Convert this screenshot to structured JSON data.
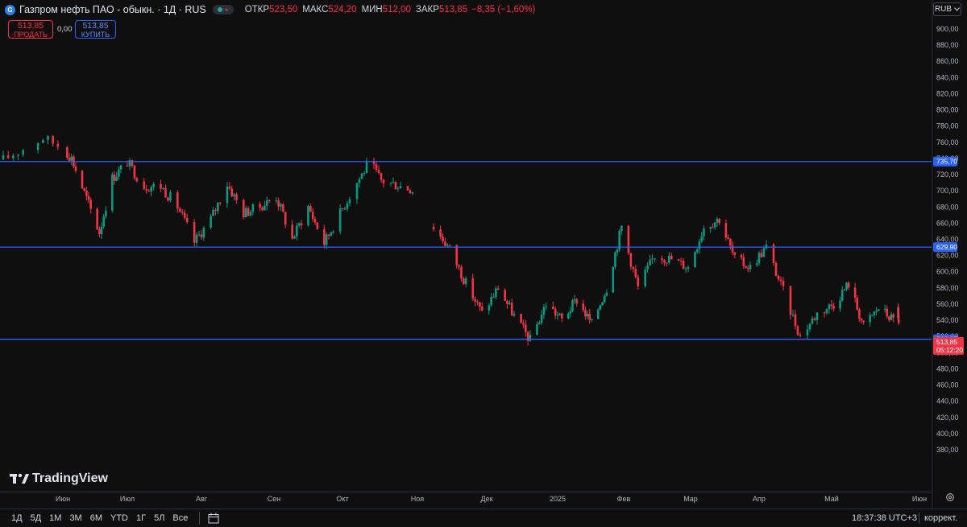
{
  "header": {
    "symbol_title": "Газпром нефть ПАО - обыкн. · 1Д · RUS",
    "logo_letter": "G",
    "open_label": "ОТКР",
    "open_value": "523,50",
    "high_label": "МАКС",
    "high_value": "524,20",
    "low_label": "МИН",
    "low_value": "512,00",
    "close_label": "ЗАКР",
    "close_value": "513,85",
    "change": "−8,35 (−1,60%)"
  },
  "trade": {
    "sell_price": "513,85",
    "sell_label": "ПРОДАТЬ",
    "spread": "0,00",
    "buy_price": "513,85",
    "buy_label": "КУПИТЬ"
  },
  "currency": "RUB",
  "brand": "TradingView",
  "timeframes": [
    "1Д",
    "5Д",
    "1М",
    "3М",
    "6М",
    "YTD",
    "1Г",
    "5Л",
    "Все"
  ],
  "clock": "18:37:38 UTC+3",
  "correction_label": "коррект.",
  "colors": {
    "up": "#089981",
    "down": "#f23645",
    "hline": "#2962ff",
    "bg": "#0f0f0f"
  },
  "chart_data": {
    "type": "candlestick",
    "y_axis": {
      "min": 360,
      "max": 900,
      "step": 20,
      "side": "right"
    },
    "x_labels": [
      "Июн",
      "Июл",
      "Авг",
      "Сен",
      "Окт",
      "Ноя",
      "Дек",
      "2025",
      "Фев",
      "Мар",
      "Апр",
      "Май",
      "Июн"
    ],
    "horizontal_lines": [
      735.7,
      629.9,
      516.05
    ],
    "last_price": 513.85,
    "countdown": "05:12:20",
    "close_path": [
      {
        "date": "2024-05-20",
        "close": 738
      },
      {
        "date": "2024-05-28",
        "close": 765
      },
      {
        "date": "2024-06-05",
        "close": 740
      },
      {
        "date": "2024-06-12",
        "close": 690
      },
      {
        "date": "2024-06-18",
        "close": 648
      },
      {
        "date": "2024-06-24",
        "close": 715
      },
      {
        "date": "2024-07-01",
        "close": 735
      },
      {
        "date": "2024-07-08",
        "close": 705
      },
      {
        "date": "2024-07-15",
        "close": 705
      },
      {
        "date": "2024-07-22",
        "close": 680
      },
      {
        "date": "2024-07-29",
        "close": 636
      },
      {
        "date": "2024-08-05",
        "close": 665
      },
      {
        "date": "2024-08-12",
        "close": 708
      },
      {
        "date": "2024-08-19",
        "close": 672
      },
      {
        "date": "2024-08-26",
        "close": 680
      },
      {
        "date": "2024-09-02",
        "close": 692
      },
      {
        "date": "2024-09-09",
        "close": 640
      },
      {
        "date": "2024-09-16",
        "close": 680
      },
      {
        "date": "2024-09-23",
        "close": 635
      },
      {
        "date": "2024-09-30",
        "close": 672
      },
      {
        "date": "2024-10-07",
        "close": 710
      },
      {
        "date": "2024-10-12",
        "close": 735
      },
      {
        "date": "2024-10-17",
        "close": 712
      },
      {
        "date": "2024-10-26",
        "close": 705
      },
      {
        "date": "2024-10-31",
        "close": 700
      },
      {
        "date": "2024-11-08",
        "close": 655
      },
      {
        "date": "2024-11-15",
        "close": 628
      },
      {
        "date": "2024-11-22",
        "close": 585
      },
      {
        "date": "2024-11-29",
        "close": 548
      },
      {
        "date": "2024-12-06",
        "close": 580
      },
      {
        "date": "2024-12-13",
        "close": 545
      },
      {
        "date": "2024-12-20",
        "close": 515
      },
      {
        "date": "2024-12-27",
        "close": 560
      },
      {
        "date": "2025-01-03",
        "close": 540
      },
      {
        "date": "2025-01-10",
        "close": 565
      },
      {
        "date": "2025-01-17",
        "close": 535
      },
      {
        "date": "2025-01-24",
        "close": 580
      },
      {
        "date": "2025-01-31",
        "close": 655
      },
      {
        "date": "2025-02-07",
        "close": 580
      },
      {
        "date": "2025-02-14",
        "close": 620
      },
      {
        "date": "2025-02-21",
        "close": 615
      },
      {
        "date": "2025-02-28",
        "close": 605
      },
      {
        "date": "2025-03-07",
        "close": 655
      },
      {
        "date": "2025-03-14",
        "close": 665
      },
      {
        "date": "2025-03-21",
        "close": 615
      },
      {
        "date": "2025-03-28",
        "close": 605
      },
      {
        "date": "2025-04-04",
        "close": 630
      },
      {
        "date": "2025-04-11",
        "close": 575
      },
      {
        "date": "2025-04-18",
        "close": 520
      },
      {
        "date": "2025-04-25",
        "close": 548
      },
      {
        "date": "2025-05-02",
        "close": 560
      },
      {
        "date": "2025-05-09",
        "close": 585
      },
      {
        "date": "2025-05-16",
        "close": 532
      },
      {
        "date": "2025-05-23",
        "close": 555
      },
      {
        "date": "2025-05-30",
        "close": 540
      },
      {
        "date": "2025-06-03",
        "close": 552
      },
      {
        "date": "2025-06-06",
        "close": 530
      },
      {
        "date": "2025-06-09",
        "close": 513.85
      }
    ]
  }
}
